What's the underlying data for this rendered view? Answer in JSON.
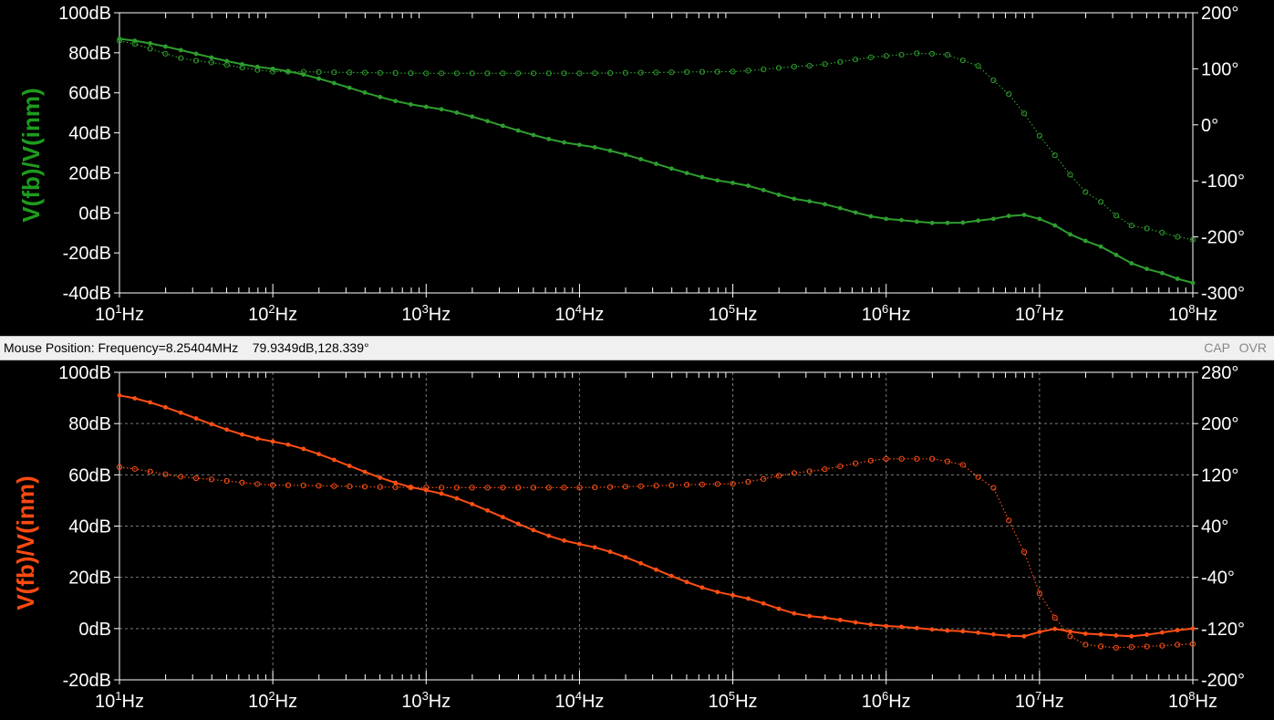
{
  "status_bar": {
    "mouse_position": "Mouse Position: Frequency=8.25404MHz    79.9349dB,128.339°",
    "cap": "CAP",
    "ovr": "OVR"
  },
  "colors": {
    "top_trace": "#2e9e2e",
    "top_label": "#1e9c1e",
    "bottom_trace": "#ff4f14",
    "bottom_label": "#ff4a10",
    "grid": "#7a7a7a",
    "axis_text": "#ffffff"
  },
  "chart_data": [
    {
      "type": "line",
      "title": "",
      "ylabel": "V(fb)/V(inm)",
      "x_scale": "log",
      "xlim": [
        10,
        100000000
      ],
      "x_ticks": [
        {
          "base": "10",
          "exp": "1",
          "unit": "Hz"
        },
        {
          "base": "10",
          "exp": "2",
          "unit": "Hz"
        },
        {
          "base": "10",
          "exp": "3",
          "unit": "Hz"
        },
        {
          "base": "10",
          "exp": "4",
          "unit": "Hz"
        },
        {
          "base": "10",
          "exp": "5",
          "unit": "Hz"
        },
        {
          "base": "10",
          "exp": "6",
          "unit": "Hz"
        },
        {
          "base": "10",
          "exp": "7",
          "unit": "Hz"
        },
        {
          "base": "10",
          "exp": "8",
          "unit": "Hz"
        }
      ],
      "ylim_left": [
        -40,
        100
      ],
      "left_ticks": [
        "100dB",
        "80dB",
        "60dB",
        "40dB",
        "20dB",
        "0dB",
        "-20dB",
        "-40dB"
      ],
      "left_tick_values": [
        100,
        80,
        60,
        40,
        20,
        0,
        -20,
        -40
      ],
      "ylim_right": [
        -300,
        200
      ],
      "right_ticks": [
        "200°",
        "100°",
        "0°",
        "-100°",
        "-200°",
        "-300°"
      ],
      "right_tick_values": [
        200,
        100,
        0,
        -100,
        -200,
        -300
      ],
      "grid": false,
      "series": [
        {
          "axis": "left",
          "style": "solid",
          "x": [
            10,
            100,
            1000,
            10000,
            100000,
            300000,
            1000000,
            2000000,
            3000000,
            5000000,
            7000000,
            8000000,
            10000000,
            20000000,
            50000000,
            100000000
          ],
          "y": [
            87,
            72,
            53,
            34,
            15,
            6,
            -3,
            -5,
            -5,
            -3,
            -1,
            -1,
            -3,
            -14,
            -28,
            -35
          ]
        },
        {
          "axis": "right",
          "style": "dotted",
          "x": [
            10,
            30,
            100,
            1000,
            10000,
            100000,
            300000,
            1000000,
            1700000,
            2500000,
            4000000,
            6000000,
            8000000,
            12000000,
            20000000,
            40000000,
            100000000
          ],
          "y": [
            150,
            115,
            95,
            92,
            92,
            95,
            105,
            123,
            128,
            125,
            105,
            60,
            20,
            -50,
            -120,
            -180,
            -205
          ]
        }
      ]
    },
    {
      "type": "line",
      "title": "",
      "ylabel": "V(fb)/V(inm)",
      "x_scale": "log",
      "xlim": [
        10,
        100000000
      ],
      "x_ticks": [
        {
          "base": "10",
          "exp": "1",
          "unit": "Hz"
        },
        {
          "base": "10",
          "exp": "2",
          "unit": "Hz"
        },
        {
          "base": "10",
          "exp": "3",
          "unit": "Hz"
        },
        {
          "base": "10",
          "exp": "4",
          "unit": "Hz"
        },
        {
          "base": "10",
          "exp": "5",
          "unit": "Hz"
        },
        {
          "base": "10",
          "exp": "6",
          "unit": "Hz"
        },
        {
          "base": "10",
          "exp": "7",
          "unit": "Hz"
        },
        {
          "base": "10",
          "exp": "8",
          "unit": "Hz"
        }
      ],
      "ylim_left": [
        -20,
        100
      ],
      "left_ticks": [
        "100dB",
        "80dB",
        "60dB",
        "40dB",
        "20dB",
        "0dB",
        "-20dB"
      ],
      "left_tick_values": [
        100,
        80,
        60,
        40,
        20,
        0,
        -20
      ],
      "ylim_right": [
        -200,
        280
      ],
      "right_ticks": [
        "280°",
        "200°",
        "120°",
        "40°",
        "-40°",
        "-120°",
        "-200°"
      ],
      "right_tick_values": [
        280,
        200,
        120,
        40,
        -40,
        -120,
        -200
      ],
      "grid": true,
      "series": [
        {
          "axis": "left",
          "style": "solid",
          "x": [
            10,
            100,
            1000,
            10000,
            100000,
            300000,
            1000000,
            3000000,
            7000000,
            8000000,
            12000000,
            20000000,
            40000000,
            100000000
          ],
          "y": [
            91,
            73,
            54,
            33,
            13,
            5,
            1,
            -1,
            -3,
            -3,
            0,
            -2,
            -3,
            0
          ],
          "smooth": true
        },
        {
          "axis": "right",
          "style": "dotted",
          "x": [
            10,
            30,
            100,
            1000,
            10000,
            100000,
            300000,
            1000000,
            2000000,
            3000000,
            5000000,
            7000000,
            10000000,
            15000000,
            20000000,
            30000000,
            50000000,
            100000000
          ],
          "y": [
            132,
            115,
            104,
            100,
            100,
            106,
            125,
            145,
            145,
            138,
            100,
            30,
            -65,
            -130,
            -145,
            -150,
            -148,
            -144
          ],
          "smooth": true
        }
      ]
    }
  ]
}
